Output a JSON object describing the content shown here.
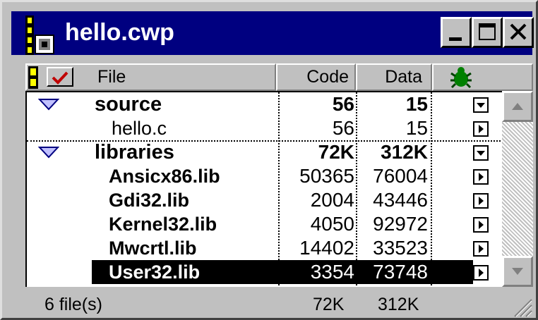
{
  "window": {
    "title": "hello.cwp"
  },
  "header": {
    "file": "File",
    "code": "Code",
    "data": "Data"
  },
  "groups": [
    {
      "name": "source",
      "code": "56",
      "data": "15",
      "files": [
        {
          "name": "hello.c",
          "code": "56",
          "data": "15"
        }
      ]
    },
    {
      "name": "libraries",
      "code": "72K",
      "data": "312K",
      "files": [
        {
          "name": "Ansicx86.lib",
          "code": "50365",
          "data": "76004"
        },
        {
          "name": "Gdi32.lib",
          "code": "2004",
          "data": "43446"
        },
        {
          "name": "Kernel32.lib",
          "code": "4050",
          "data": "92972"
        },
        {
          "name": "Mwcrtl.lib",
          "code": "14402",
          "data": "33523"
        },
        {
          "name": "User32.lib",
          "code": "3354",
          "data": "73748"
        }
      ]
    }
  ],
  "status": {
    "files": "6 file(s)",
    "code_total": "72K",
    "data_total": "312K"
  },
  "selected_file": "User32.lib",
  "icons": {
    "window": "project-file-icon",
    "header_marker": "yellow-marker-icon",
    "header_check": "checkmark-icon",
    "debug": "bug-icon",
    "group_toggle": "triangle-down-icon",
    "expanded": "menu-down-icon",
    "collapsed": "menu-right-icon"
  },
  "colors": {
    "titlebar": "#000080",
    "selection": "#000000",
    "bug": "#008000",
    "marker": "#ffff00"
  }
}
